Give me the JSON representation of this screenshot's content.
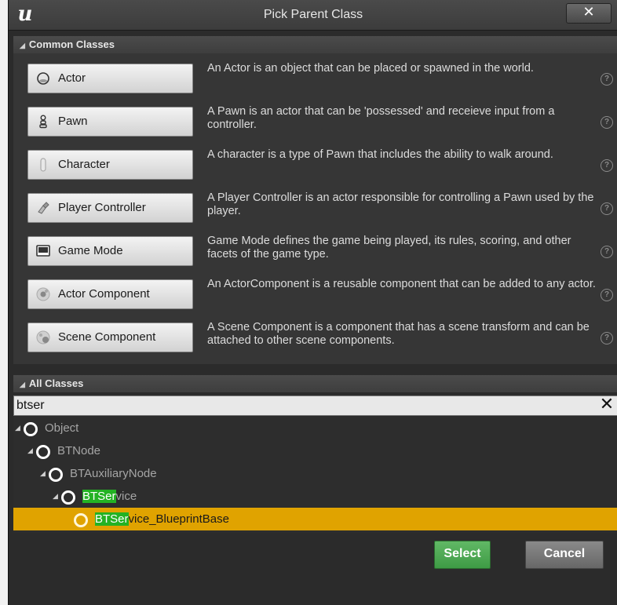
{
  "window": {
    "title": "Pick Parent Class",
    "close_label": "✕"
  },
  "common": {
    "header": "Common Classes",
    "help_glyph": "?",
    "items": [
      {
        "label": "Actor",
        "icon": "actor-sphere-icon",
        "description": "An Actor is an object that can be placed or spawned in the world."
      },
      {
        "label": "Pawn",
        "icon": "pawn-figure-icon",
        "description": "A Pawn is an actor that can be 'possessed' and receieve input from a controller."
      },
      {
        "label": "Character",
        "icon": "character-capsule-icon",
        "description": "A character is a type of Pawn that includes the ability to walk around."
      },
      {
        "label": "Player Controller",
        "icon": "player-controller-icon",
        "description": "A Player Controller is an actor responsible for controlling a Pawn used by the player."
      },
      {
        "label": "Game Mode",
        "icon": "game-mode-icon",
        "description": "Game Mode defines the game being played, its rules, scoring, and other facets of the game type."
      },
      {
        "label": "Actor Component",
        "icon": "actor-component-icon",
        "description": "An ActorComponent is a reusable component that can be added to any actor."
      },
      {
        "label": "Scene Component",
        "icon": "scene-component-icon",
        "description": "A Scene Component is a component that has a scene transform and can be attached to other scene components."
      }
    ]
  },
  "all": {
    "header": "All Classes",
    "search_value": "btser",
    "clear_label": "✕",
    "tree": [
      {
        "name": "Object",
        "match": "",
        "rest": "Object",
        "selected": false
      },
      {
        "name": "BTNode",
        "match": "",
        "rest": "BTNode",
        "selected": false
      },
      {
        "name": "BTAuxiliaryNode",
        "match": "",
        "rest": "BTAuxiliaryNode",
        "selected": false
      },
      {
        "name": "BTService",
        "match": "BTSer",
        "rest": "vice",
        "selected": false
      },
      {
        "name": "BTService_BlueprintBase",
        "match": "BTSer",
        "rest": "vice_BlueprintBase",
        "selected": true
      }
    ]
  },
  "footer": {
    "select_label": "Select",
    "cancel_label": "Cancel"
  },
  "colors": {
    "accent_selection": "#e0a300",
    "match_highlight": "#23b223",
    "select_button": "#4caf50"
  }
}
